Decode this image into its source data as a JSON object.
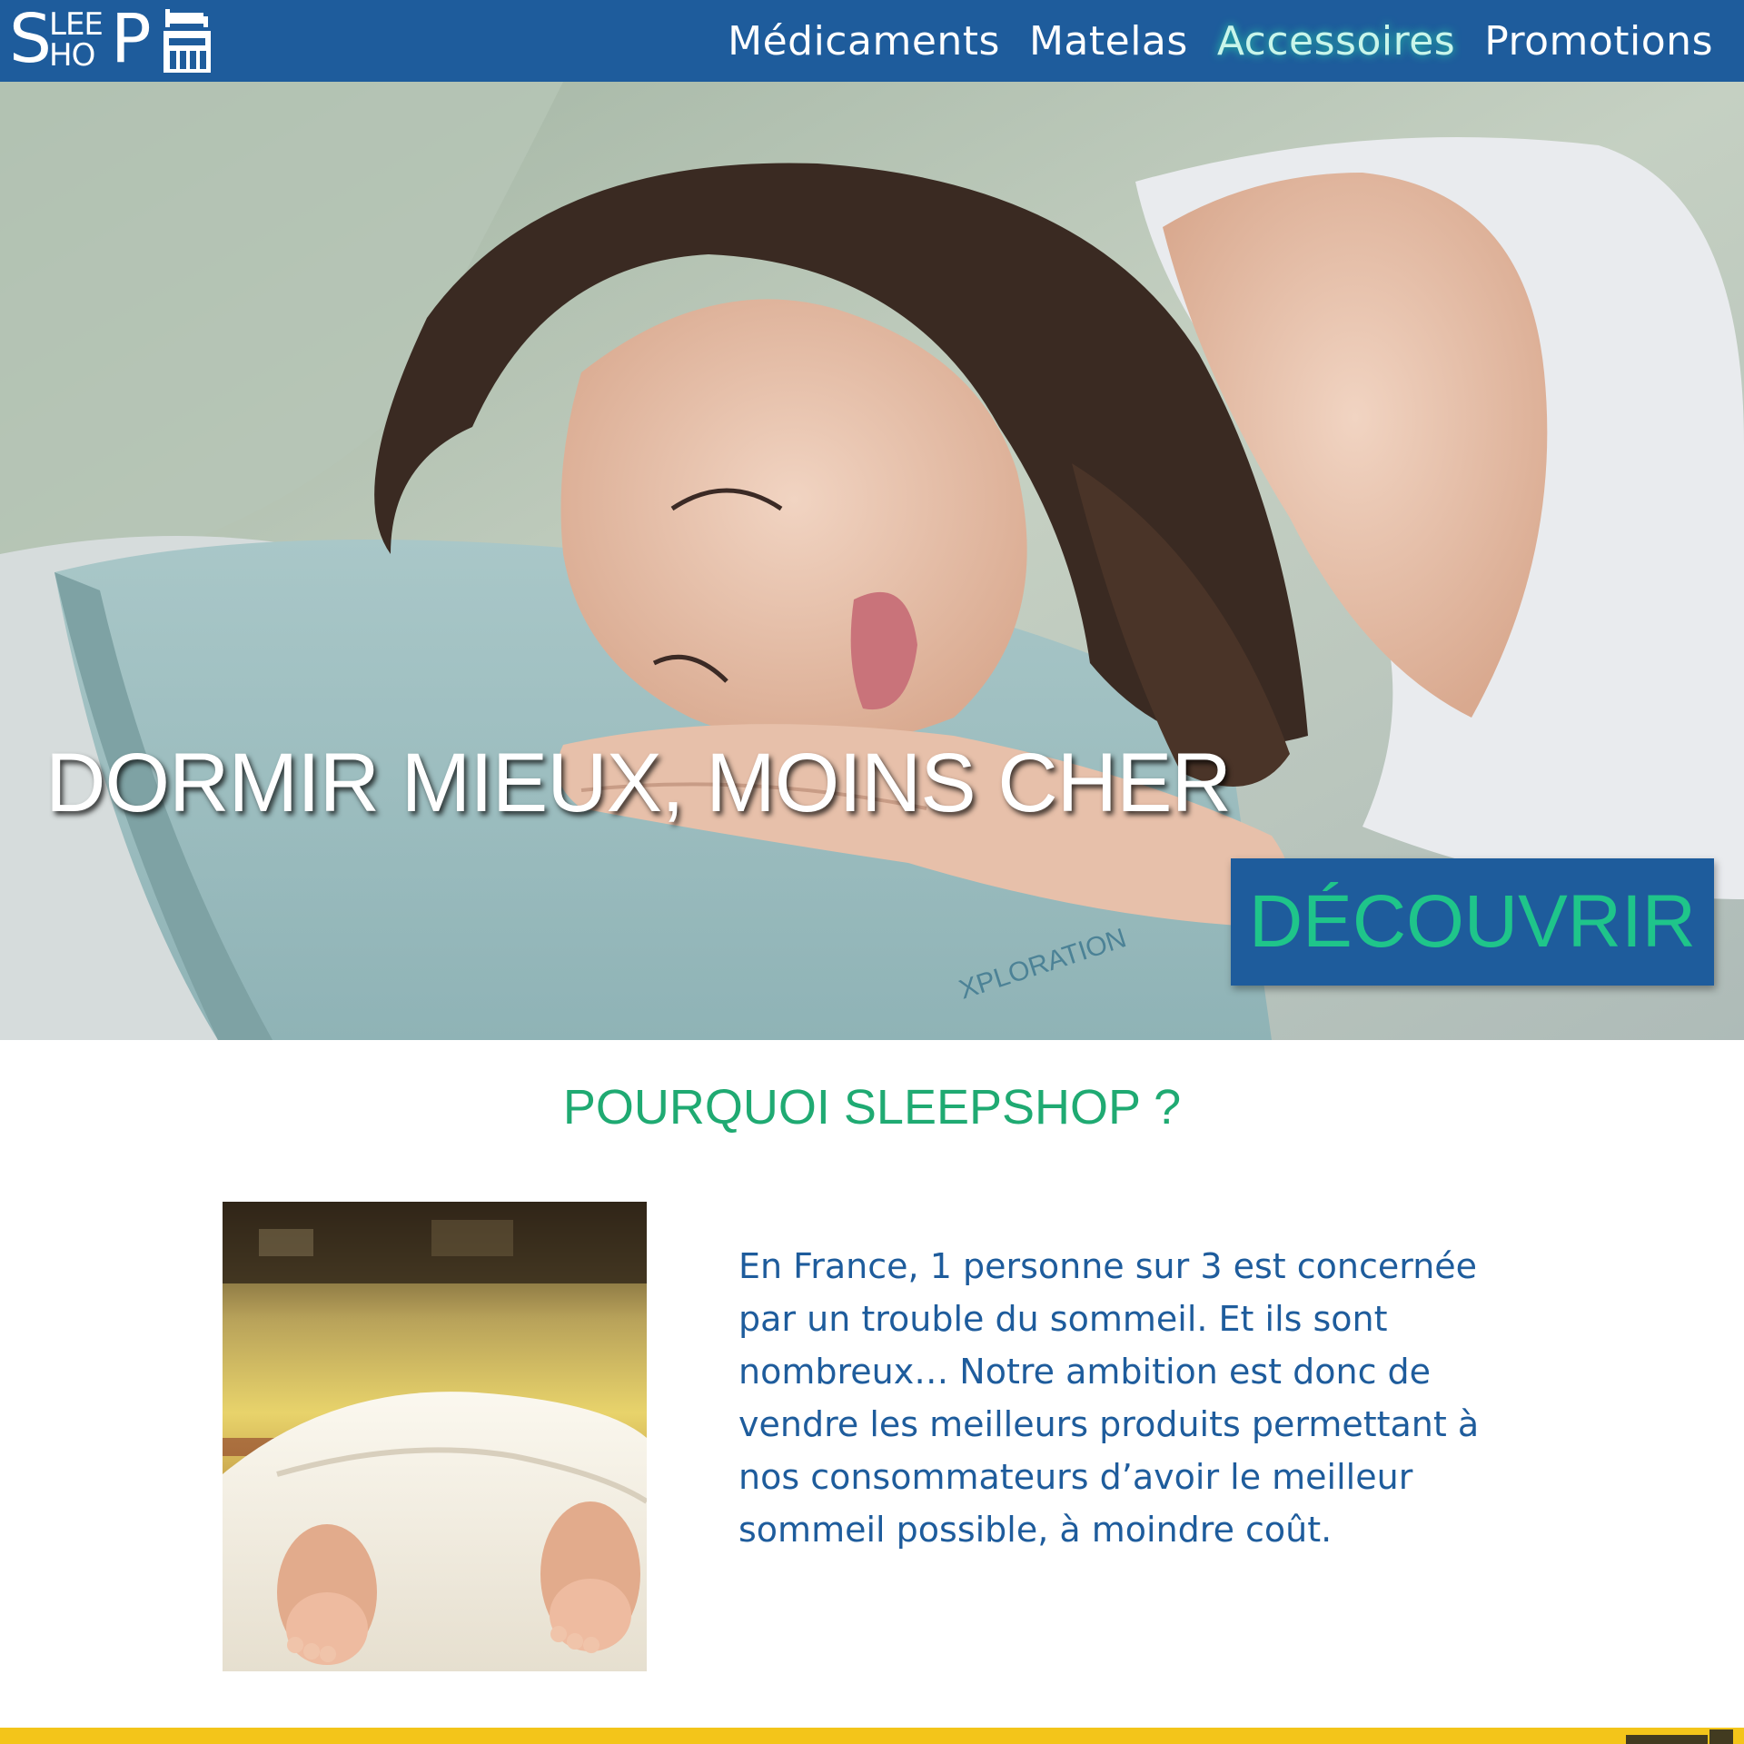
{
  "header": {
    "logo": {
      "s": "S",
      "lee": "LEE",
      "ho": "HO",
      "p": "P",
      "icon": "storefront-icon"
    },
    "nav": [
      {
        "label": "Médicaments",
        "active": false
      },
      {
        "label": "Matelas",
        "active": false
      },
      {
        "label": "Accessoires",
        "active": true
      },
      {
        "label": "Promotions",
        "active": false
      }
    ],
    "colors": {
      "background": "#1e5c9c",
      "active_glow": "#28dcaa"
    }
  },
  "hero": {
    "title": "DORMIR MIEUX, MOINS CHER",
    "button_label": "DÉCOUVRIR",
    "image": "woman-sleeping-on-pillow",
    "colors": {
      "button_bg": "#1e5c9c",
      "button_text": "#1fc58a"
    }
  },
  "why": {
    "title": "POURQUOI SLEEPSHOP ?",
    "image": "feet-under-white-sheets",
    "paragraph": "En France, 1 personne sur 3 est concernée par un trouble du sommeil. Et ils sont nombreux… Notre ambition est donc de vendre les meilleurs produits permettant à nos consommateurs d’avoir le meilleur sommeil possible, à moindre coût.",
    "colors": {
      "title": "#1faa72",
      "text": "#1e5c9c"
    }
  },
  "footer": {
    "colors": {
      "strip": "#f3c51a"
    }
  }
}
